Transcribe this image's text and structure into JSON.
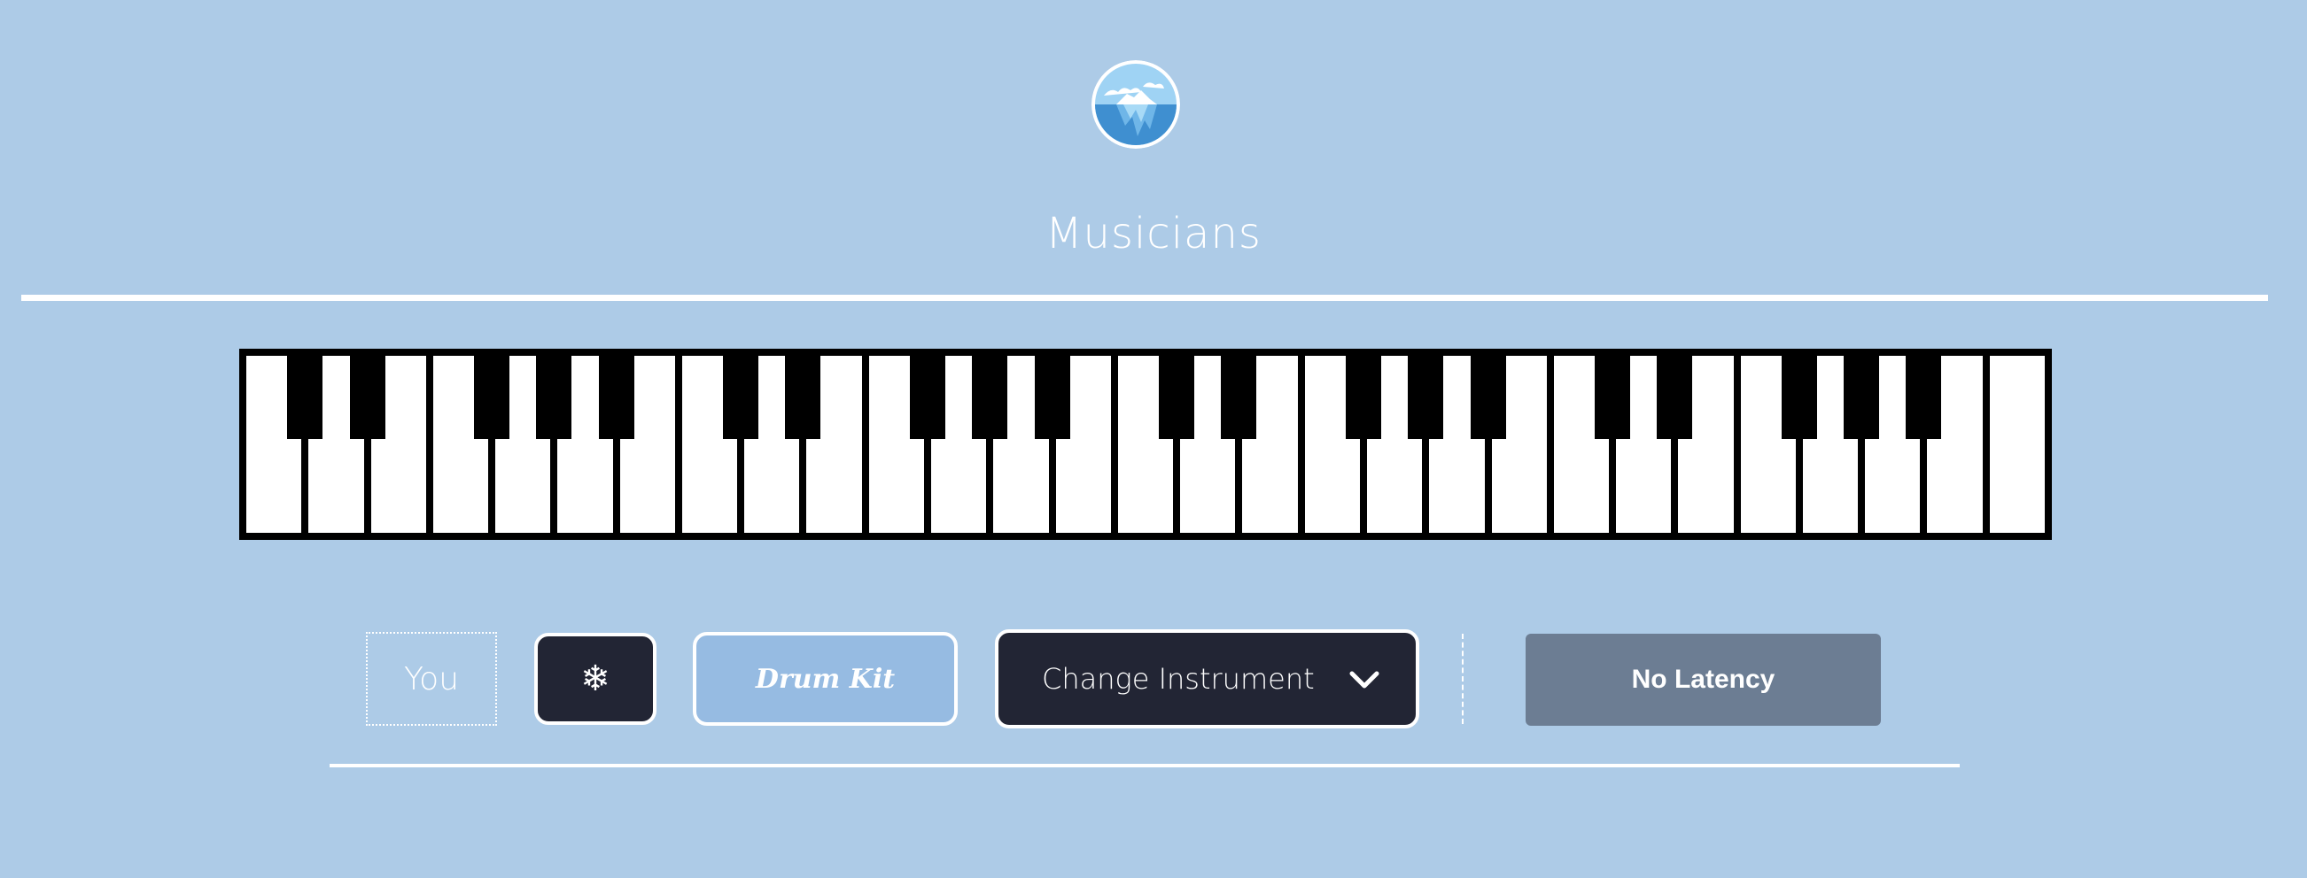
{
  "header": {
    "logo_icon": "iceberg-logo-icon",
    "title": "Musicians"
  },
  "piano": {
    "white_keys": 29,
    "black_key_pattern": "standard",
    "colors": {
      "white": "#ffffff",
      "black": "#000000"
    }
  },
  "controls": {
    "name_label": "You",
    "freeze_icon": "snowflake-icon",
    "freeze_glyph": "❄",
    "drum_label": "Drum Kit",
    "instrument_select_label": "Change Instrument",
    "latency_label": "No Latency"
  },
  "colors": {
    "background": "#adcbe7",
    "dark_button": "#222534",
    "drum_button": "#96bbe2",
    "latency_button": "#6c7d93"
  }
}
